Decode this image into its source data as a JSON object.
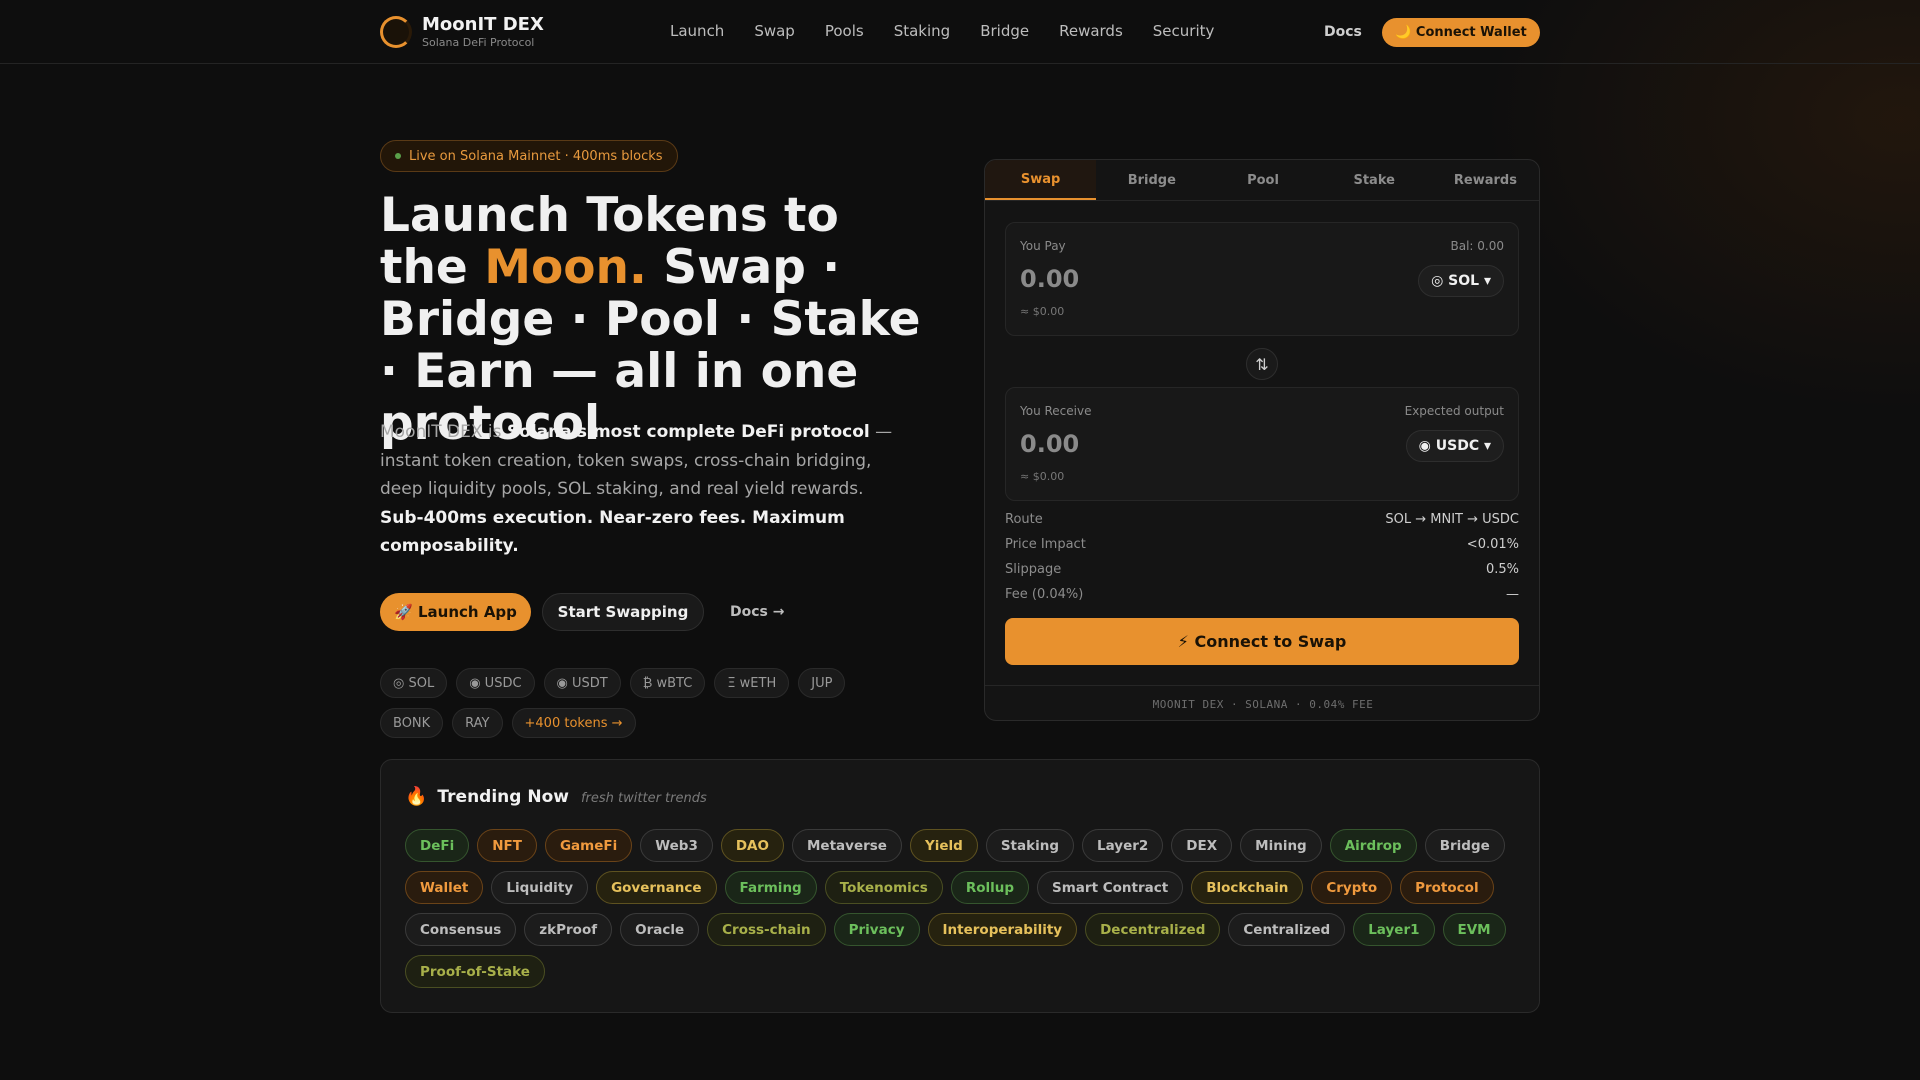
{
  "nav": {
    "brand": "MoonIT DEX",
    "tagline": "Solana DeFi Protocol",
    "links": [
      "Launch",
      "Swap",
      "Pools",
      "Staking",
      "Bridge",
      "Rewards",
      "Security"
    ],
    "docs": "Docs",
    "connect": "🌙 Connect Wallet"
  },
  "hero": {
    "badge": "Live on Solana Mainnet · 400ms blocks",
    "title_1": "Launch Tokens to the",
    "title_accent": "Moon.",
    "title_2": " Swap · Bridge · Pool · Stake · Earn — all in one protocol",
    "desc_1": "MoonIT DEX is ",
    "desc_bold_1": "Solana's most complete DeFi protocol",
    "desc_2": " — instant token creation, token swaps, cross-chain bridging, deep liquidity pools, SOL staking, and real yield rewards. ",
    "desc_bold_2": "Sub-400ms execution. Near-zero fees. Maximum composability.",
    "btn_launch": "🚀 Launch App",
    "btn_swap": "Start Swapping",
    "btn_docs": "Docs →",
    "tokens": [
      "◎ SOL",
      "◉ USDC",
      "◉ USDT",
      "₿ wBTC",
      "Ξ wETH",
      "JUP",
      "BONK",
      "RAY"
    ],
    "more_tokens": "+400 tokens →"
  },
  "swap": {
    "tabs": [
      "Swap",
      "Bridge",
      "Pool",
      "Stake",
      "Rewards"
    ],
    "active_tab": "Swap",
    "pay": {
      "label": "You Pay",
      "right": "Bal: 0.00",
      "amount": "0.00",
      "usd": "≈ $0.00",
      "token": "◎ SOL ▾"
    },
    "receive": {
      "label": "You Receive",
      "right": "Expected output",
      "amount": "0.00",
      "usd": "≈ $0.00",
      "token": "◉ USDC ▾"
    },
    "flip": "⇅",
    "details": [
      {
        "k": "Route",
        "v": "SOL → MNIT → USDC"
      },
      {
        "k": "Price Impact",
        "v": "<0.01%"
      },
      {
        "k": "Slippage",
        "v": "0.5%"
      },
      {
        "k": "Fee (0.04%)",
        "v": "—"
      }
    ],
    "cta": "⚡ Connect to Swap",
    "footer": "MOONIT DEX · SOLANA · 0.04% FEE"
  },
  "trending": {
    "icon": "🔥",
    "title": "Trending Now",
    "subtitle": "fresh twitter trends",
    "tags": [
      {
        "label": "DeFi",
        "tone": "green"
      },
      {
        "label": "NFT",
        "tone": "orange"
      },
      {
        "label": "GameFi",
        "tone": "orange"
      },
      {
        "label": "Web3",
        "tone": "gray"
      },
      {
        "label": "DAO",
        "tone": "yellow"
      },
      {
        "label": "Metaverse",
        "tone": "gray"
      },
      {
        "label": "Yield",
        "tone": "yellow"
      },
      {
        "label": "Staking",
        "tone": "gray"
      },
      {
        "label": "Layer2",
        "tone": "gray"
      },
      {
        "label": "DEX",
        "tone": "gray"
      },
      {
        "label": "Mining",
        "tone": "gray"
      },
      {
        "label": "Airdrop",
        "tone": "green"
      },
      {
        "label": "Bridge",
        "tone": "gray"
      },
      {
        "label": "Wallet",
        "tone": "orange"
      },
      {
        "label": "Liquidity",
        "tone": "gray"
      },
      {
        "label": "Governance",
        "tone": "yellow"
      },
      {
        "label": "Farming",
        "tone": "green"
      },
      {
        "label": "Tokenomics",
        "tone": "olive"
      },
      {
        "label": "Rollup",
        "tone": "green"
      },
      {
        "label": "Smart Contract",
        "tone": "gray"
      },
      {
        "label": "Blockchain",
        "tone": "yellow"
      },
      {
        "label": "Crypto",
        "tone": "orange"
      },
      {
        "label": "Protocol",
        "tone": "orange"
      },
      {
        "label": "Consensus",
        "tone": "gray"
      },
      {
        "label": "zkProof",
        "tone": "gray"
      },
      {
        "label": "Oracle",
        "tone": "gray"
      },
      {
        "label": "Cross-chain",
        "tone": "olive"
      },
      {
        "label": "Privacy",
        "tone": "green"
      },
      {
        "label": "Interoperability",
        "tone": "yellow"
      },
      {
        "label": "Decentralized",
        "tone": "olive"
      },
      {
        "label": "Centralized",
        "tone": "gray"
      },
      {
        "label": "Layer1",
        "tone": "green"
      },
      {
        "label": "EVM",
        "tone": "green"
      },
      {
        "label": "Proof-of-Stake",
        "tone": "olive"
      }
    ]
  },
  "colors": {
    "accent": "#e8912e",
    "background": "#0e0e0e",
    "card": "#141414"
  }
}
